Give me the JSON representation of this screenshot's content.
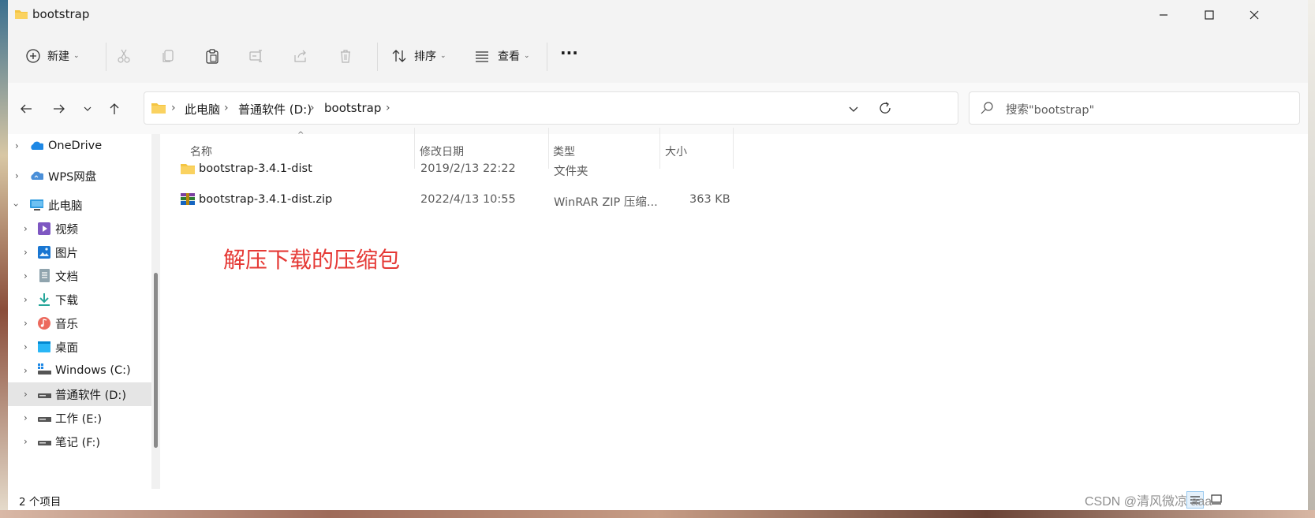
{
  "window": {
    "title": "bootstrap"
  },
  "toolbar": {
    "new_label": "新建",
    "sort_label": "排序",
    "view_label": "查看",
    "more_label": "···"
  },
  "address": {
    "crumbs": [
      "此电脑",
      "普通软件 (D:)",
      "bootstrap"
    ]
  },
  "search": {
    "placeholder": "搜索\"bootstrap\""
  },
  "sidebar": {
    "items": [
      {
        "label": "OneDrive",
        "icon": "onedrive-cloud-icon"
      },
      {
        "label": "WPS网盘",
        "icon": "wps-cloud-icon"
      },
      {
        "label": "此电脑",
        "icon": "computer-icon"
      },
      {
        "label": "视频",
        "icon": "video-icon"
      },
      {
        "label": "图片",
        "icon": "pictures-icon"
      },
      {
        "label": "文档",
        "icon": "documents-icon"
      },
      {
        "label": "下载",
        "icon": "download-icon"
      },
      {
        "label": "音乐",
        "icon": "music-icon"
      },
      {
        "label": "桌面",
        "icon": "desktop-icon"
      },
      {
        "label": "Windows (C:)",
        "icon": "drive-c-icon"
      },
      {
        "label": "普通软件 (D:)",
        "icon": "drive-icon"
      },
      {
        "label": "工作 (E:)",
        "icon": "drive-icon"
      },
      {
        "label": "笔记 (F:)",
        "icon": "drive-icon"
      }
    ]
  },
  "columns": {
    "name": "名称",
    "date": "修改日期",
    "type": "类型",
    "size": "大小"
  },
  "files": [
    {
      "name": "bootstrap-3.4.1-dist",
      "date": "2019/2/13 22:22",
      "type": "文件夹",
      "size": ""
    },
    {
      "name": "bootstrap-3.4.1-dist.zip",
      "date": "2022/4/13 10:55",
      "type": "WinRAR ZIP 压缩...",
      "size": "363 KB"
    }
  ],
  "annotation": "解压下载的压缩包",
  "status": {
    "count": "2 个项目"
  },
  "watermark": "CSDN @清风微凉 aaa",
  "colors": {
    "folder": "#f4c542",
    "annotation": "#e53935",
    "selected": "#e5e5e5"
  }
}
